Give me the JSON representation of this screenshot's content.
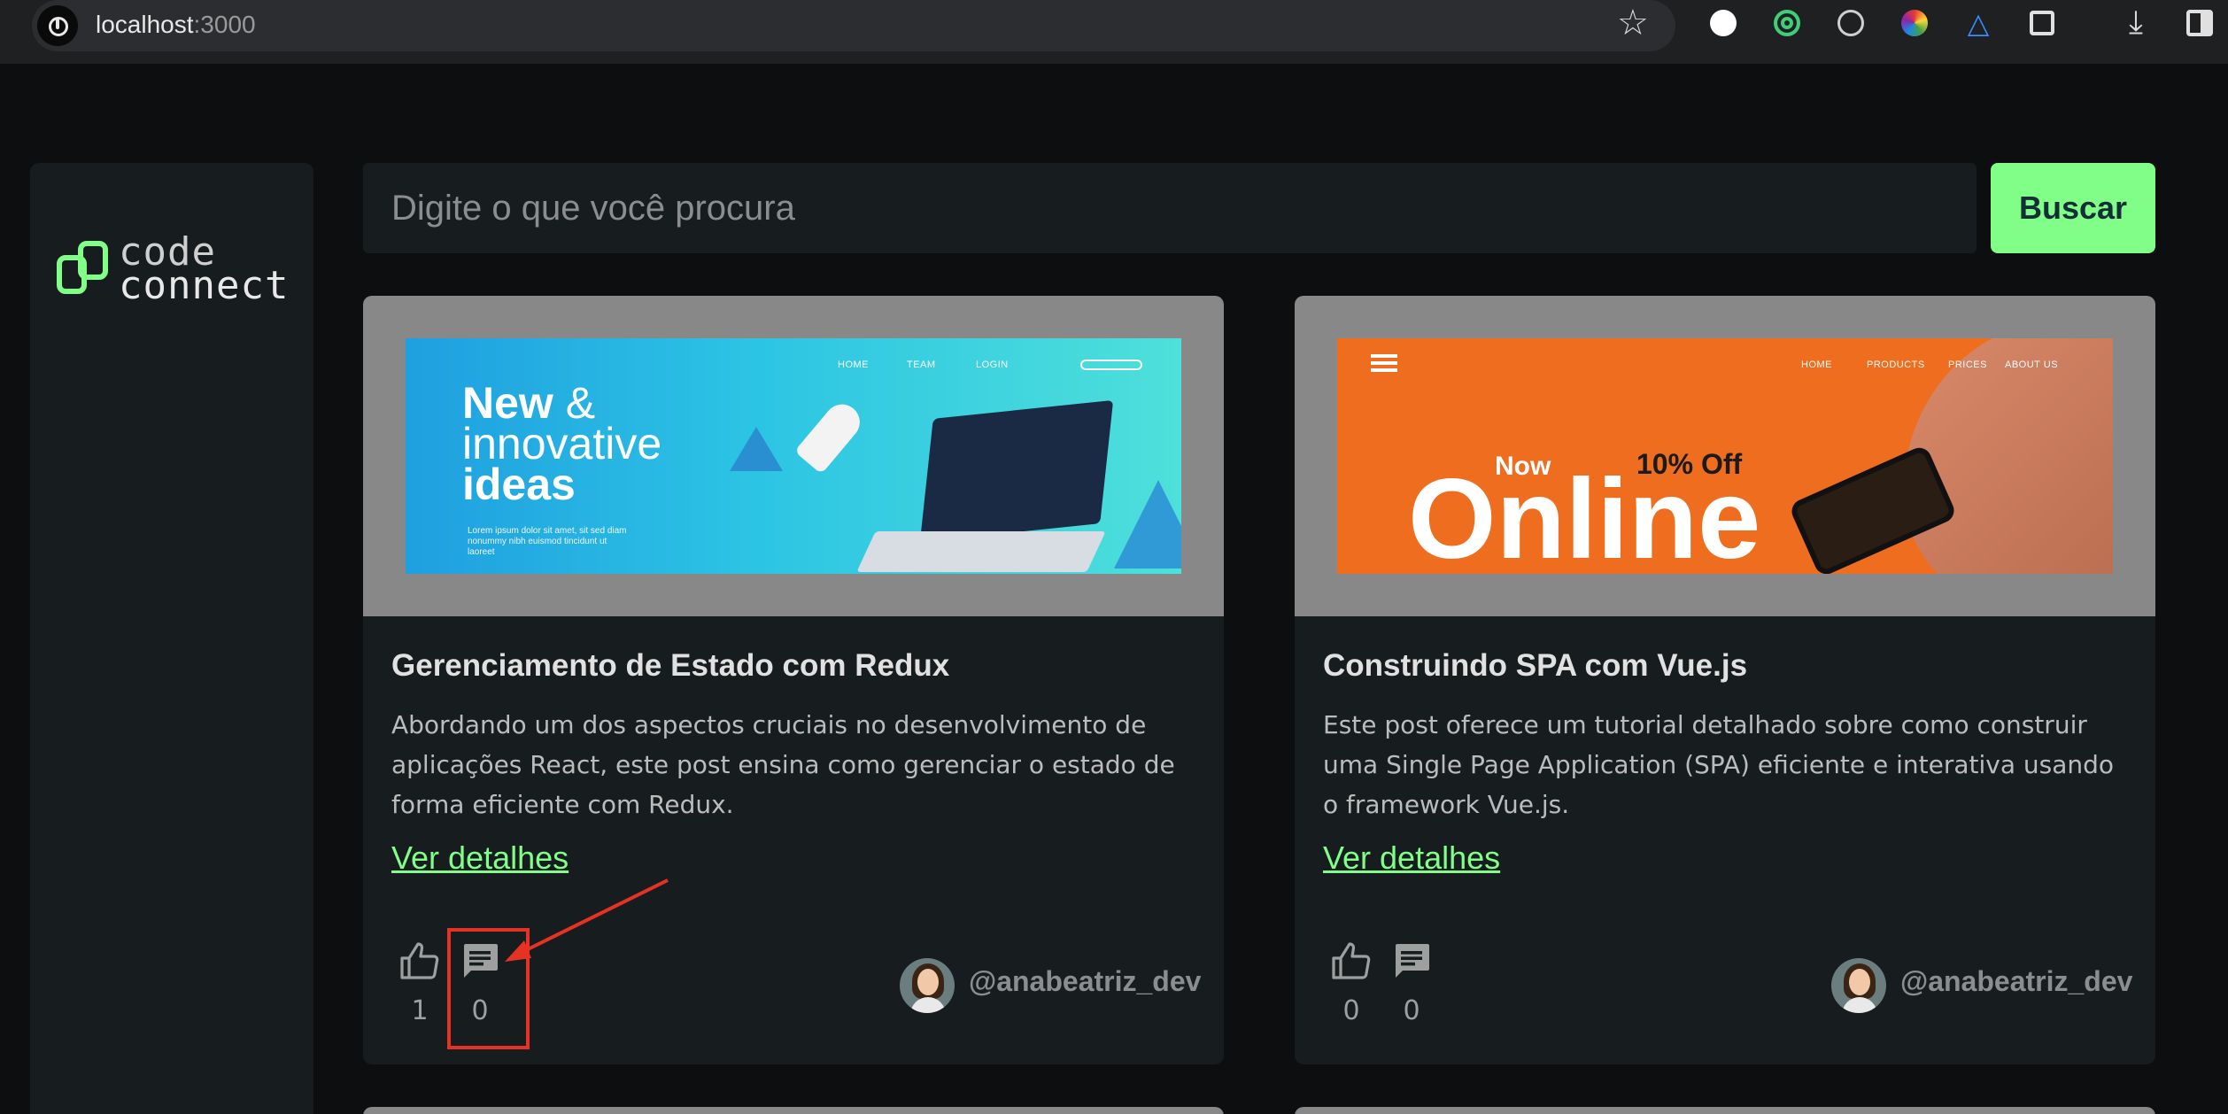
{
  "browser": {
    "url_host": "localhost",
    "url_port": ":3000"
  },
  "sidebar": {
    "logo_line1": "code",
    "logo_line2": "connect"
  },
  "search": {
    "placeholder": "Digite o que você procura",
    "button_label": "Buscar"
  },
  "posts": [
    {
      "title": "Gerenciamento de Estado com Redux",
      "body": "Abordando um dos aspectos cruciais no desenvolvimento de aplicações React, este post ensina como gerenciar o estado de forma eficiente com Redux.",
      "link_label": "Ver detalhes",
      "likes": "1",
      "comments": "0",
      "author": "@anabeatriz_dev",
      "banner": {
        "nav": [
          "HOME",
          "TEAM",
          "LOGIN"
        ],
        "headline_1": "New",
        "headline_amp": "&",
        "headline_2": "innovative",
        "headline_3": "ideas",
        "small_text": "Lorem ipsum dolor sit amet, sit sed diam nonummy nibh euismod tincidunt ut laoreet"
      }
    },
    {
      "title": "Construindo SPA com Vue.js",
      "body": "Este post oferece um tutorial detalhado sobre como construir uma Single Page Application (SPA) eficiente e interativa usando o framework Vue.js.",
      "link_label": "Ver detalhes",
      "likes": "0",
      "comments": "0",
      "author": "@anabeatriz_dev",
      "banner": {
        "nav": [
          "HOME",
          "PRODUCTS",
          "PRICES",
          "ABOUT US"
        ],
        "now": "Now",
        "offer": "10% Off",
        "online": "Online"
      }
    }
  ],
  "colors": {
    "accent": "#81fe88",
    "background": "#0c0e0f",
    "card": "#171d1f",
    "annotation": "#e53223"
  }
}
